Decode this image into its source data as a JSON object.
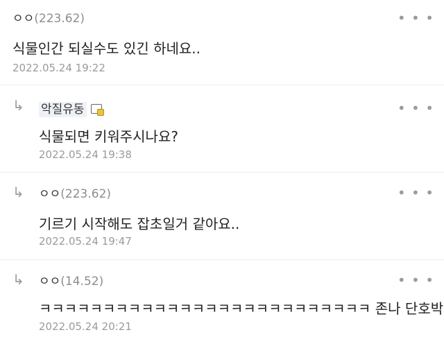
{
  "more_label": "• • •",
  "reply_arrow": "↳",
  "comments": [
    {
      "nick": "ㅇㅇ",
      "ip": "(223.62)",
      "text": "식물인간 되실수도 있긴 하네요..",
      "date": "2022.05.24 19:22"
    },
    {
      "nick": "악질유동",
      "ip": "",
      "text": "식물되면 키워주시나요?",
      "date": "2022.05.24 19:38",
      "badge": "gallery-badge-icon"
    },
    {
      "nick": "ㅇㅇ",
      "ip": "(223.62)",
      "text": "기르기 시작해도 잡초일거 같아요..",
      "date": "2022.05.24 19:47"
    },
    {
      "nick": "ㅇㅇ",
      "ip": "(14.52)",
      "text": "ㅋㅋㅋㅋㅋㅋㅋㅋㅋㅋㅋㅋㅋㅋㅋㅋㅋㅋㅋㅋㅋㅋㅋㅋㅋㅋ 존나 단호박",
      "date": "2022.05.24 20:21"
    }
  ]
}
